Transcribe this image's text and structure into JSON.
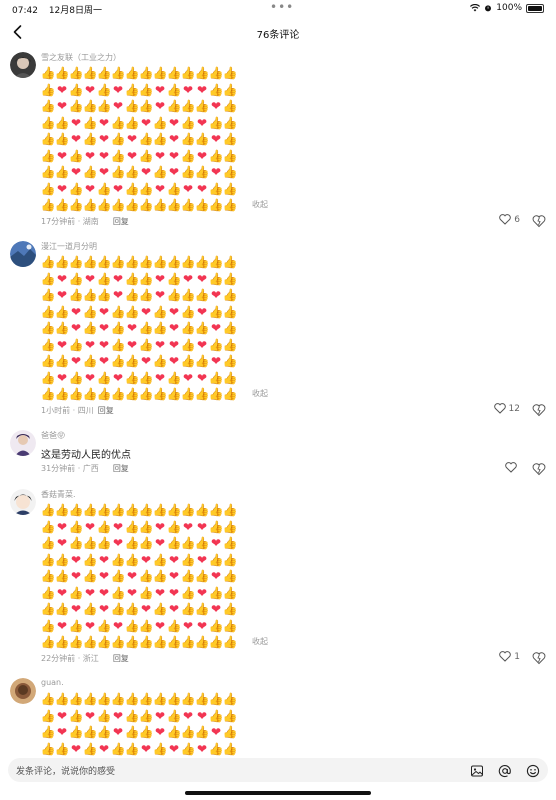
{
  "status_bar": {
    "time": "07:42",
    "date": "12月8日周一",
    "battery": "100%"
  },
  "header": {
    "title": "76条评论"
  },
  "emoji_pattern": [
    "TTTTTTTTTTTTTT",
    "THTHTHTTHTHHTT",
    "THTTTHTTHTTTHT",
    "TTHTHTTHTHTHTT",
    "TTHTHTHTTHTTHT",
    "THTHHTHTHHTHTT",
    "TTHTHTTHTHTTHT",
    "THTHTHTTHTHHTT",
    "TTTTTTTTTTTTTT"
  ],
  "comments": [
    {
      "username": "雪之友联（工业之力）",
      "collapse": "收起",
      "time_location": "17分钟前 · 湖南",
      "reply": "回复",
      "likes": "6"
    },
    {
      "username": "漫江一道月分明",
      "collapse": "收起",
      "time_location": "1小时前 · 四川",
      "reply": "回复",
      "likes": "12"
    },
    {
      "username": "爸爸😝",
      "text": "这是劳动人民的优点",
      "time_location": "31分钟前 · 广西",
      "reply": "回复",
      "likes": ""
    },
    {
      "username": "香菇青菜.",
      "collapse": "收起",
      "time_location": "22分钟前 · 浙江",
      "reply": "回复",
      "likes": "1"
    },
    {
      "username": "guan."
    }
  ],
  "input": {
    "placeholder": "发条评论，说说你的感受"
  },
  "icons": {
    "image": "image-icon",
    "at": "at-icon",
    "emoji": "emoji-icon"
  }
}
